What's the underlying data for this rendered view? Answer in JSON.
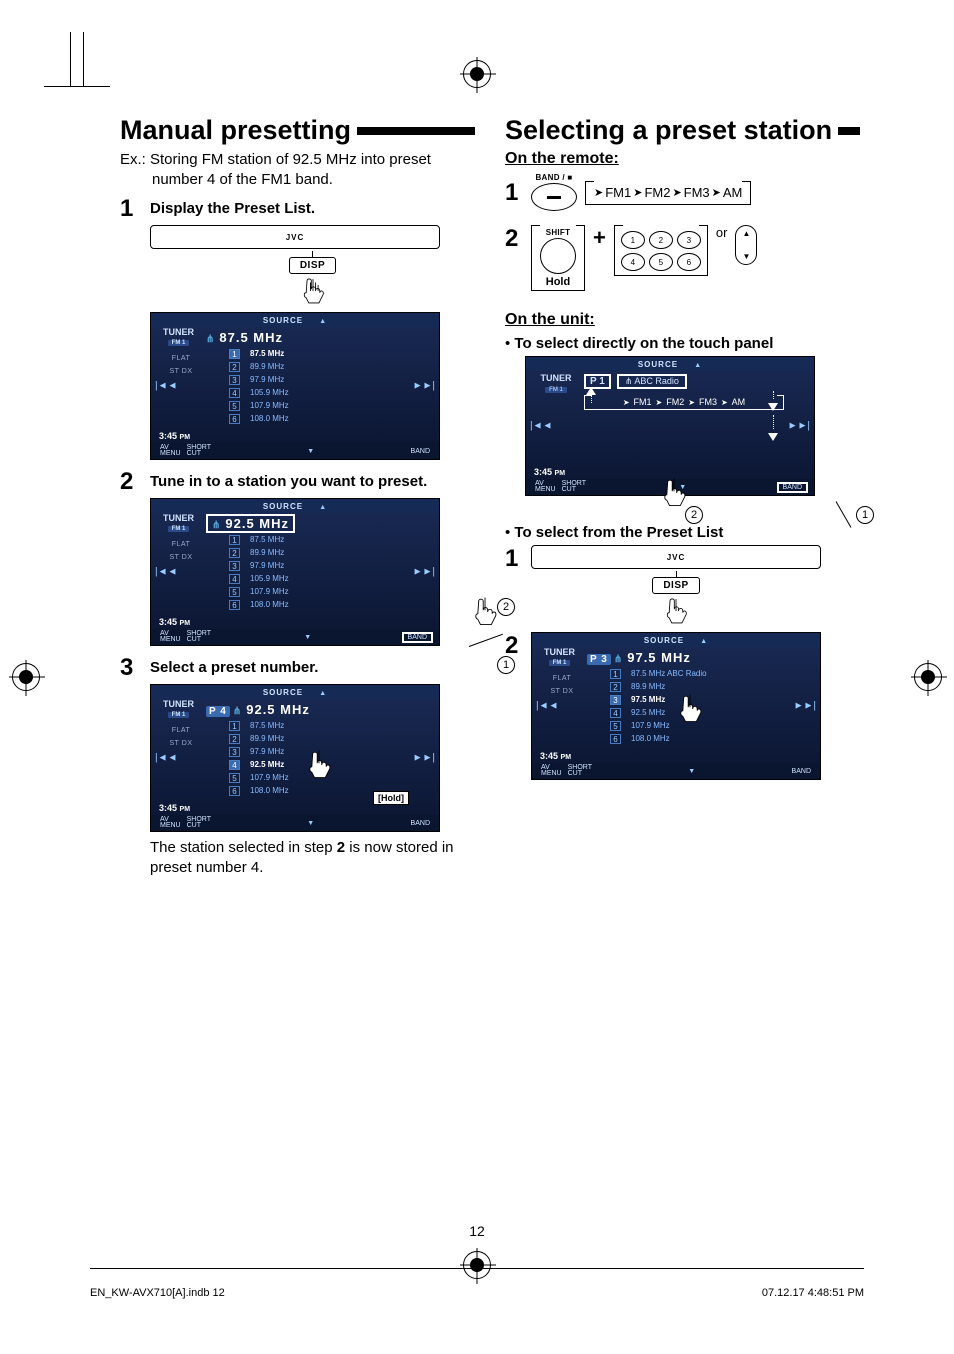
{
  "page_number": "12",
  "footer_left": "EN_KW-AVX710[A].indb   12",
  "footer_right": "07.12.17   4:48:51 PM",
  "left": {
    "heading": "Manual presetting",
    "example": "Ex.:  Storing FM station of 92.5 MHz into preset number 4 of the FM1 band.",
    "steps": {
      "s1": {
        "num": "1",
        "title": "Display the Preset List."
      },
      "s2": {
        "num": "2",
        "title": "Tune in to a station you want to preset."
      },
      "s3": {
        "num": "3",
        "title": "Select a preset number."
      }
    },
    "result_text": "The station selected in step 2 is now stored in preset number 4.",
    "disp_label": "DISP",
    "iconbar_brand": "JVC",
    "hold_label": "[Hold]",
    "panel_common": {
      "source": "SOURCE",
      "tuner": "TUNER",
      "band_sub": "FM 1",
      "flat": "FLAT",
      "st_dx": "ST  DX",
      "time": "3:45",
      "time_ampm": "PM",
      "av_menu": "AV\nMENU",
      "short_cut": "SHORT\nCUT",
      "band": "BAND"
    },
    "panel1": {
      "freq": "87.5 MHz",
      "presets": [
        {
          "n": "1",
          "v": "87.5 MHz",
          "active": true
        },
        {
          "n": "2",
          "v": "89.9 MHz"
        },
        {
          "n": "3",
          "v": "97.9 MHz"
        },
        {
          "n": "4",
          "v": "105.9 MHz"
        },
        {
          "n": "5",
          "v": "107.9 MHz"
        },
        {
          "n": "6",
          "v": "108.0 MHz"
        }
      ]
    },
    "panel2": {
      "freq": "92.5 MHz",
      "presets": [
        {
          "n": "1",
          "v": "87.5 MHz"
        },
        {
          "n": "2",
          "v": "89.9 MHz"
        },
        {
          "n": "3",
          "v": "97.9 MHz"
        },
        {
          "n": "4",
          "v": "105.9 MHz"
        },
        {
          "n": "5",
          "v": "107.9 MHz"
        },
        {
          "n": "6",
          "v": "108.0 MHz"
        }
      ]
    },
    "panel3": {
      "preset_badge": "P 4",
      "freq": "92.5 MHz",
      "presets": [
        {
          "n": "1",
          "v": "87.5 MHz"
        },
        {
          "n": "2",
          "v": "89.9 MHz"
        },
        {
          "n": "3",
          "v": "97.9 MHz"
        },
        {
          "n": "4",
          "v": "92.5 MHz",
          "active": true
        },
        {
          "n": "5",
          "v": "107.9 MHz"
        },
        {
          "n": "6",
          "v": "108.0 MHz"
        }
      ]
    }
  },
  "right": {
    "heading": "Selecting a preset station",
    "on_remote": "On the remote:",
    "on_unit": "On the unit:",
    "direct_touch": "To select directly on the touch panel",
    "from_list": "To select from the Preset List",
    "remote1": {
      "num": "1",
      "band_label": "BAND / ■",
      "cycle": [
        "FM1",
        "FM2",
        "FM3",
        "AM"
      ]
    },
    "remote2": {
      "num": "2",
      "shift": "SHIFT",
      "hold": "Hold",
      "keys": [
        "1",
        "2",
        "3",
        "4",
        "5",
        "6"
      ],
      "or": "or"
    },
    "sel_panel": {
      "p": "P 1",
      "abc": "ABC Radio",
      "cycle": [
        "FM1",
        "FM2",
        "FM3",
        "AM"
      ]
    },
    "list_step1": "1",
    "list_step2": "2",
    "list_panel": {
      "p": "P 3",
      "freq": "97.5 MHz",
      "presets": [
        {
          "n": "1",
          "v": "87.5 MHz  ABC Radio"
        },
        {
          "n": "2",
          "v": "89.9 MHz"
        },
        {
          "n": "3",
          "v": "97.5 MHz",
          "active": true
        },
        {
          "n": "4",
          "v": "92.5 MHz"
        },
        {
          "n": "5",
          "v": "107.9 MHz"
        },
        {
          "n": "6",
          "v": "108.0 MHz"
        }
      ]
    }
  }
}
